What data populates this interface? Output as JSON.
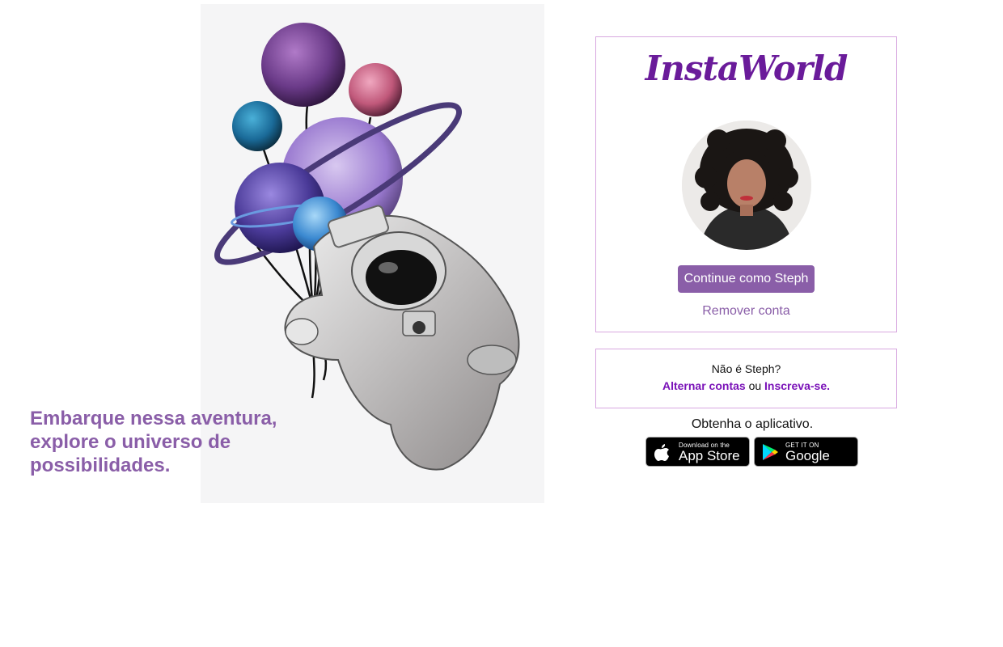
{
  "hero": {
    "tagline": "Embarque nessa aventura, explore o universo de possibilidades.",
    "illustration": "astronaut-holding-planet-balloons"
  },
  "login_card": {
    "logo_text": "InstaWorld",
    "avatar": "user-profile-photo",
    "continue_label": "Continue como Steph",
    "remove_label": "Remover conta"
  },
  "switch_card": {
    "not_user_text": "Não é Steph?",
    "switch_label": "Alternar contas",
    "or_text": "ou",
    "signup_label": "Inscreva-se."
  },
  "app_download": {
    "title": "Obtenha o aplicativo.",
    "app_store": {
      "small": "Download on the",
      "big": "App Store"
    },
    "google_play": {
      "small": "GET IT ON",
      "big": "Google Play"
    }
  },
  "colors": {
    "accent": "#8a5ea8",
    "logo": "#6a1b9a",
    "link": "#7a12b8",
    "border": "#d8a8e0"
  }
}
